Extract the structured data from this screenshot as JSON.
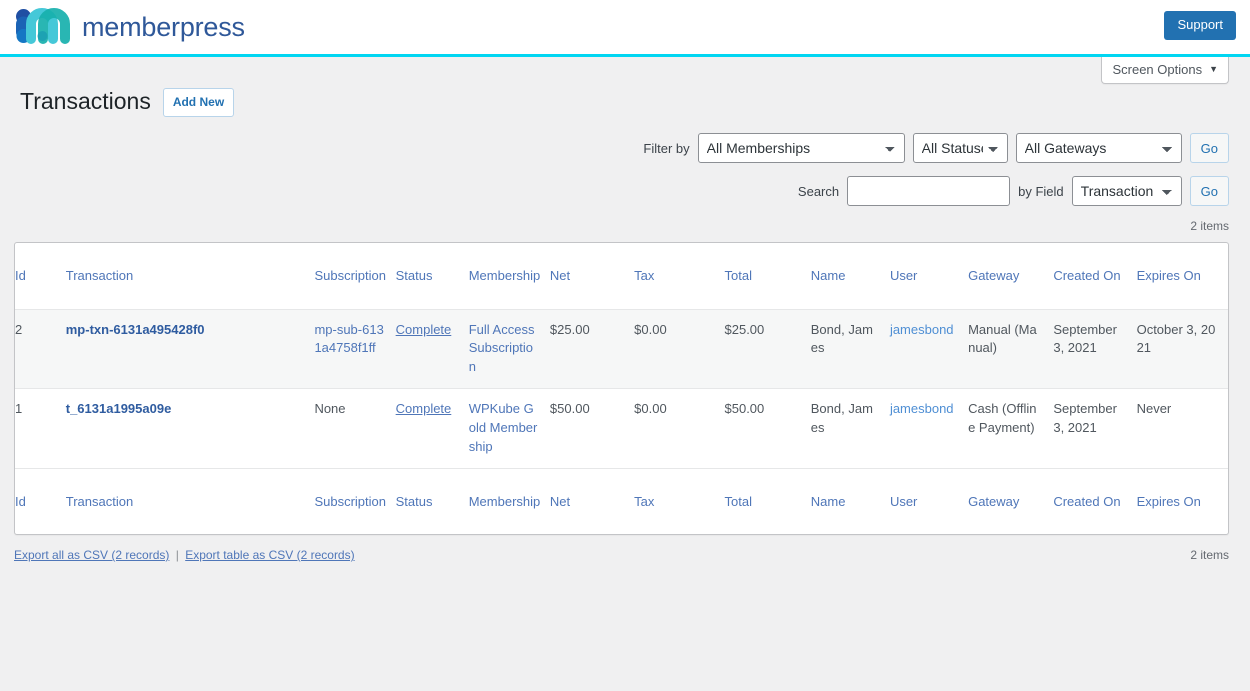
{
  "brand": {
    "logo_icon": "memberpress-m-logo-icon",
    "wordmark": "memberpress",
    "support_label": "Support",
    "accent_color": "#00d6f2",
    "logo_blue": "#2f5899",
    "logo_teal": "#2bbfc0",
    "support_bg": "#2271b1"
  },
  "screen_options": {
    "label": "Screen Options",
    "caret_icon": "caret-down-icon"
  },
  "header": {
    "title": "Transactions",
    "add_new_label": "Add New"
  },
  "filters": {
    "filter_by_label": "Filter by",
    "membership_selected": "All Memberships",
    "status_selected": "All Statuses",
    "gateway_selected": "All Gateways",
    "go_label_1": "Go",
    "search_label": "Search",
    "search_value": "",
    "search_placeholder": "",
    "by_field_label": "by Field",
    "field_selected": "Transaction",
    "go_label_2": "Go"
  },
  "counts": {
    "top": "2 items",
    "bottom": "2 items"
  },
  "table": {
    "columns": [
      {
        "key": "id",
        "label": "Id"
      },
      {
        "key": "transaction",
        "label": "Transaction"
      },
      {
        "key": "subscription",
        "label": "Subscription"
      },
      {
        "key": "status",
        "label": "Status"
      },
      {
        "key": "membership",
        "label": "Membership"
      },
      {
        "key": "net",
        "label": "Net"
      },
      {
        "key": "tax",
        "label": "Tax"
      },
      {
        "key": "total",
        "label": "Total"
      },
      {
        "key": "name",
        "label": "Name"
      },
      {
        "key": "user",
        "label": "User"
      },
      {
        "key": "gateway",
        "label": "Gateway"
      },
      {
        "key": "created_on",
        "label": "Created On"
      },
      {
        "key": "expires_on",
        "label": "Expires On"
      }
    ],
    "rows": [
      {
        "id": "2",
        "transaction": "mp-txn-6131a495428f0",
        "subscription": "mp-sub-6131a4758f1ff",
        "subscription_is_link": true,
        "status": "Complete",
        "membership": "Full Access Subscription",
        "net": "$25.00",
        "tax": "$0.00",
        "total": "$25.00",
        "name": "Bond, James",
        "user": "jamesbond",
        "gateway": "Manual (Manual)",
        "created_on": "September 3, 2021",
        "expires_on": "October 3, 2021"
      },
      {
        "id": "1",
        "transaction": "t_6131a1995a09e",
        "subscription": "None",
        "subscription_is_link": false,
        "status": "Complete",
        "membership": "WPKube Gold Membership",
        "net": "$50.00",
        "tax": "$0.00",
        "total": "$50.00",
        "name": "Bond, James",
        "user": "jamesbond",
        "gateway": "Cash (Offline Payment)",
        "created_on": "September 3, 2021",
        "expires_on": "Never"
      }
    ]
  },
  "exports": {
    "all_label": "Export all as CSV (2 records)",
    "separator": "|",
    "table_label": "Export table as CSV (2 records)"
  }
}
